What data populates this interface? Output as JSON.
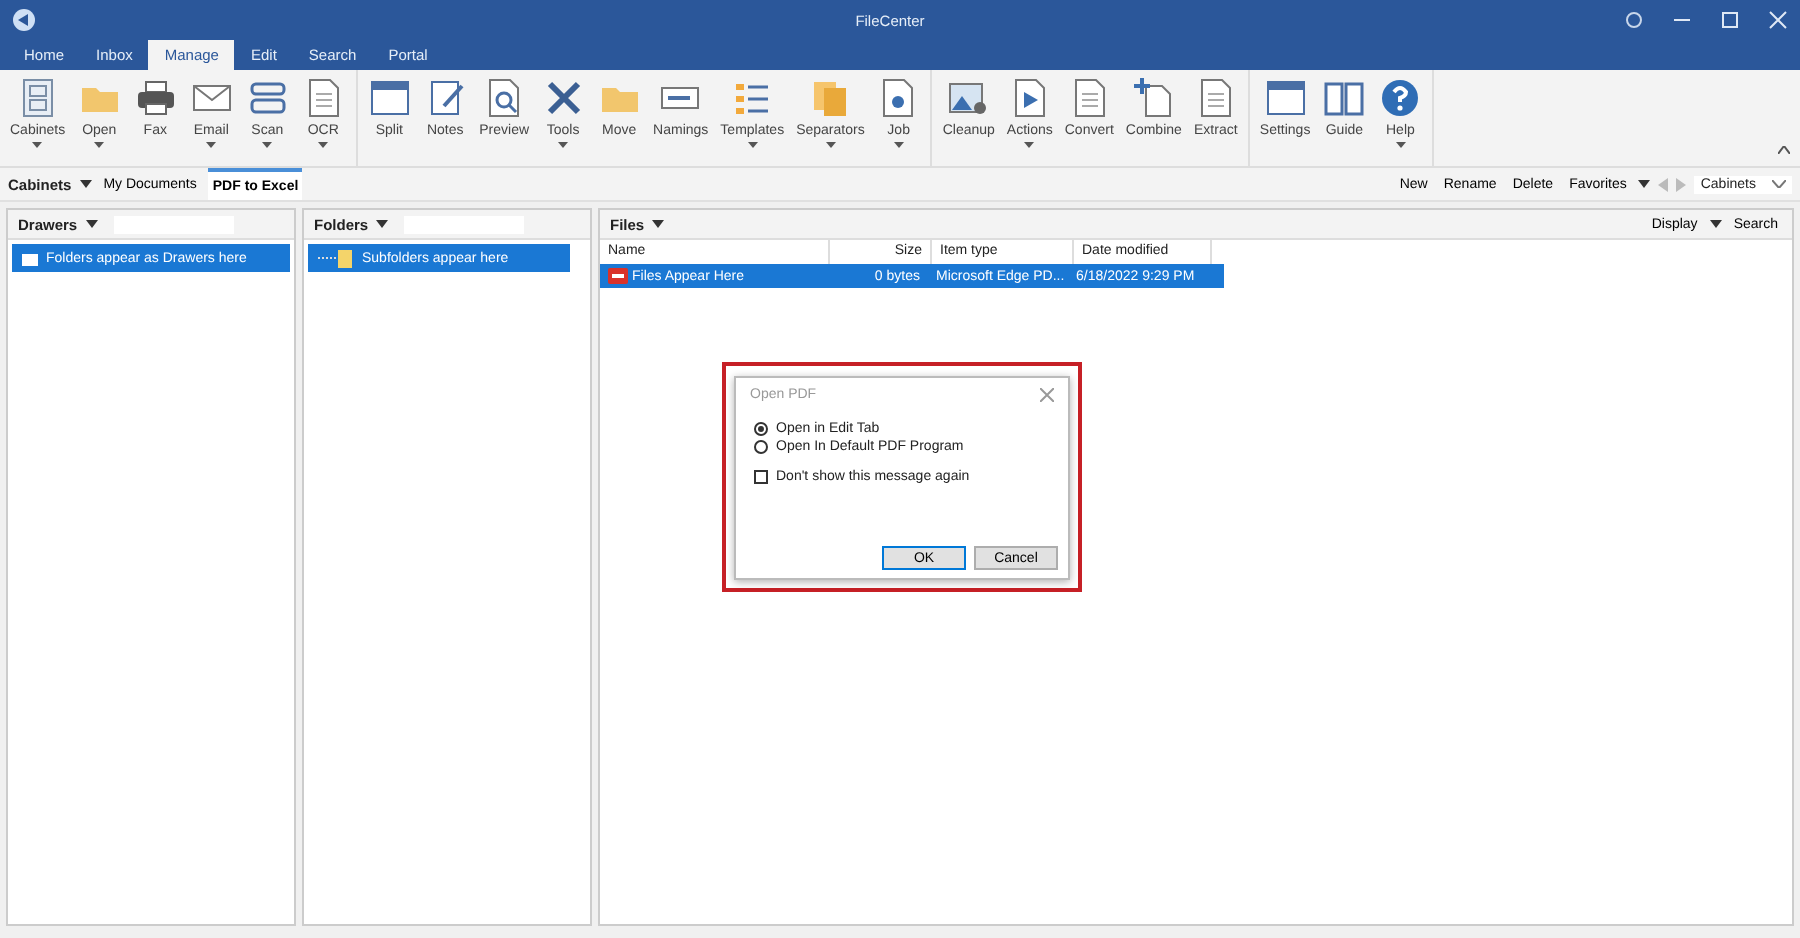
{
  "window": {
    "title": "FileCenter"
  },
  "tabs": [
    {
      "label": "Home",
      "selected": false
    },
    {
      "label": "Inbox",
      "selected": false
    },
    {
      "label": "Manage",
      "selected": true
    },
    {
      "label": "Edit",
      "selected": false
    },
    {
      "label": "Search",
      "selected": false
    },
    {
      "label": "Portal",
      "selected": false
    }
  ],
  "ribbon_groups": [
    [
      {
        "label": "Cabinets",
        "dropdown": true
      },
      {
        "label": "Open",
        "dropdown": true
      },
      {
        "label": "Fax",
        "dropdown": false
      },
      {
        "label": "Email",
        "dropdown": true
      },
      {
        "label": "Scan",
        "dropdown": true
      },
      {
        "label": "OCR",
        "dropdown": true
      }
    ],
    [
      {
        "label": "Split",
        "dropdown": false
      },
      {
        "label": "Notes",
        "dropdown": false
      },
      {
        "label": "Preview",
        "dropdown": false
      },
      {
        "label": "Tools",
        "dropdown": true
      },
      {
        "label": "Move",
        "dropdown": false
      },
      {
        "label": "Namings",
        "dropdown": false
      },
      {
        "label": "Templates",
        "dropdown": true
      },
      {
        "label": "Separators",
        "dropdown": true
      },
      {
        "label": "Job",
        "dropdown": true
      }
    ],
    [
      {
        "label": "Cleanup",
        "dropdown": false
      },
      {
        "label": "Actions",
        "dropdown": true
      },
      {
        "label": "Convert",
        "dropdown": false
      },
      {
        "label": "Combine",
        "dropdown": false
      },
      {
        "label": "Extract",
        "dropdown": false
      }
    ],
    [
      {
        "label": "Settings",
        "dropdown": false
      },
      {
        "label": "Guide",
        "dropdown": false
      },
      {
        "label": "Help",
        "dropdown": true
      }
    ]
  ],
  "cabinet_bar": {
    "label": "Cabinets",
    "tabs": [
      {
        "label": "My Documents",
        "selected": false
      },
      {
        "label": "PDF to Excel",
        "selected": true
      }
    ],
    "actions": [
      "New",
      "Rename",
      "Delete",
      "Favorites"
    ],
    "selector": "Cabinets"
  },
  "drawers": {
    "title": "Drawers",
    "items": [
      {
        "label": "Folders appear as Drawers here",
        "selected": true
      }
    ]
  },
  "folders": {
    "title": "Folders",
    "items": [
      {
        "label": "Subfolders appear here",
        "selected": true
      }
    ]
  },
  "files": {
    "title": "Files",
    "actions": [
      "Display",
      "Search"
    ],
    "columns": [
      "Name",
      "Size",
      "Item type",
      "Date modified"
    ],
    "rows": [
      {
        "cells": [
          "Files Appear Here",
          "0 bytes",
          "Microsoft Edge PD...",
          "6/18/2022 9:29 PM"
        ],
        "selected": true
      }
    ]
  },
  "dialog": {
    "title": "Open PDF",
    "options": [
      {
        "label": "Open in Edit Tab",
        "selected": true
      },
      {
        "label": "Open In Default PDF Program",
        "selected": false
      }
    ],
    "checkbox": {
      "label": "Don't show this message again",
      "checked": false
    },
    "buttons": [
      "OK",
      "Cancel"
    ]
  }
}
